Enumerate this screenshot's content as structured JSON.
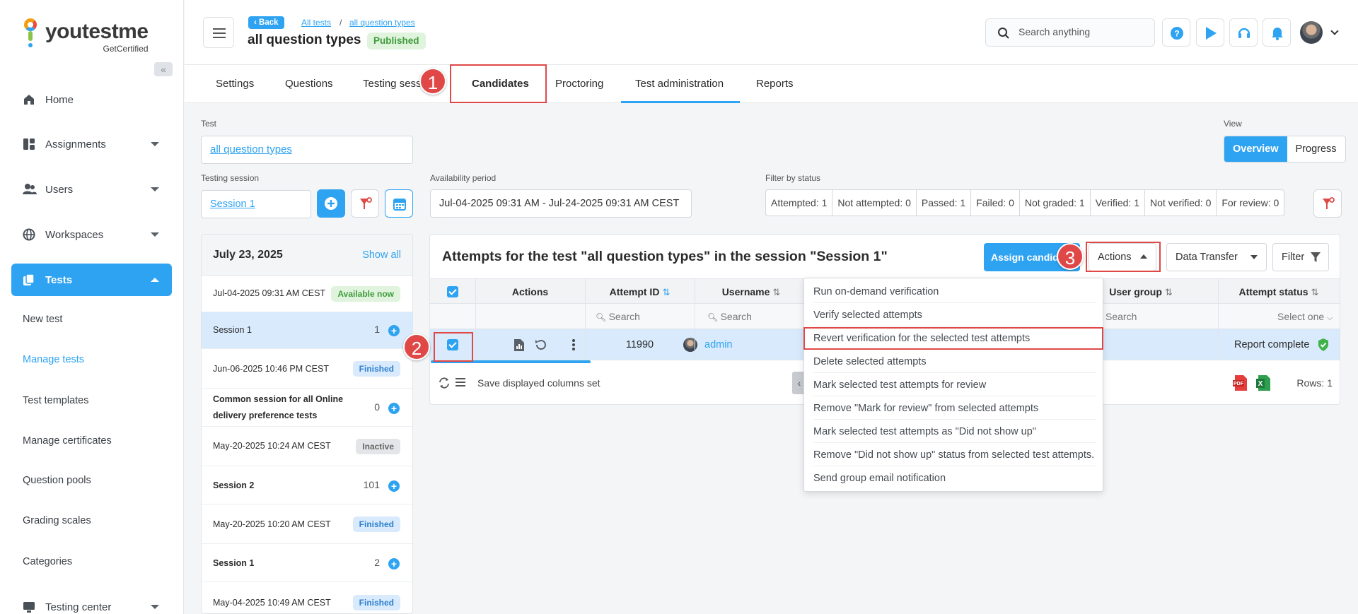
{
  "sidebar": {
    "logo_text": "youtestme",
    "logo_sub": "GetCertified",
    "nav": [
      {
        "label": "Home",
        "icon": "home-icon"
      },
      {
        "label": "Assignments",
        "icon": "assignments-icon"
      },
      {
        "label": "Users",
        "icon": "users-icon"
      },
      {
        "label": "Workspaces",
        "icon": "globe-icon"
      },
      {
        "label": "Tests",
        "icon": "tests-icon"
      },
      {
        "label": "Testing center",
        "icon": "monitor-icon"
      }
    ],
    "sub_items": [
      "New test",
      "Manage tests",
      "Test templates",
      "Manage certificates",
      "Question pools",
      "Grading scales",
      "Categories"
    ]
  },
  "header": {
    "back": "Back",
    "crumb1": "All tests",
    "crumb_sep": "/",
    "crumb2": "all question types",
    "title": "all question types",
    "status": "Published",
    "search_placeholder": "Search anything"
  },
  "tabs": [
    "Settings",
    "Questions",
    "Testing sess",
    "Candidates",
    "Proctoring",
    "Test administration",
    "Reports"
  ],
  "markers": [
    "1",
    "2",
    "3"
  ],
  "form": {
    "test_label": "Test",
    "test_value": "all question types",
    "session_label": "Testing session",
    "session_value": "Session 1",
    "availability_label": "Availability period",
    "availability_value": "Jul-04-2025 09:31 AM - Jul-24-2025 09:31 AM CEST",
    "filter_label": "Filter by status",
    "view_label": "View",
    "view_options": [
      "Overview",
      "Progress"
    ]
  },
  "status_filters": [
    "Attempted: 1",
    "Not attempted: 0",
    "Passed: 1",
    "Failed: 0",
    "Not graded: 1",
    "Verified: 1",
    "Not verified: 0",
    "For review: 0"
  ],
  "sessions": {
    "date": "July 23, 2025",
    "show_all": "Show all",
    "rows": [
      {
        "text": "Jul-04-2025 09:31 AM CEST",
        "badge": "Available now"
      },
      {
        "text": "Session 1",
        "count": "1"
      },
      {
        "text": "Jun-06-2025 10:46 PM CEST",
        "badge": "Finished"
      },
      {
        "text": "Common session for all Online",
        "text2": "delivery preference tests",
        "count": "0"
      },
      {
        "text": "May-20-2025 10:24 AM CEST",
        "badge": "Inactive"
      },
      {
        "text": "Session 2",
        "count": "101"
      },
      {
        "text": "May-20-2025 10:20 AM CEST",
        "badge": "Finished"
      },
      {
        "text": "Session 1",
        "count": "2"
      },
      {
        "text": "May-04-2025 10:49 AM CEST",
        "badge": "Finished"
      }
    ]
  },
  "grid": {
    "title": "Attempts for the test \"all question types\" in the session \"Session 1\"",
    "assign_btn": "Assign candidates",
    "actions_btn": "Actions",
    "data_transfer_btn": "Data Transfer",
    "filter_btn": "Filter",
    "columns": {
      "actions": "Actions",
      "attempt_id": "Attempt ID",
      "username": "Username",
      "user_group": "User group",
      "attempt_status": "Attempt status"
    },
    "search": "Search",
    "select_one": "Select one",
    "row": {
      "attempt_id": "11990",
      "username": "admin",
      "status": "Report complete"
    },
    "save_columns": "Save displayed columns set",
    "rows_count": "Rows: 1"
  },
  "actions_menu": [
    "Run on-demand verification",
    "Verify selected attempts",
    "Revert verification for the selected test attempts",
    "Delete selected attempts",
    "Mark selected test attempts for review",
    "Remove \"Mark for review\" from selected attempts",
    "Mark selected test attempts as \"Did not show up\"",
    "Remove \"Did not show up\" status from selected test attempts.",
    "Send group email notification"
  ]
}
